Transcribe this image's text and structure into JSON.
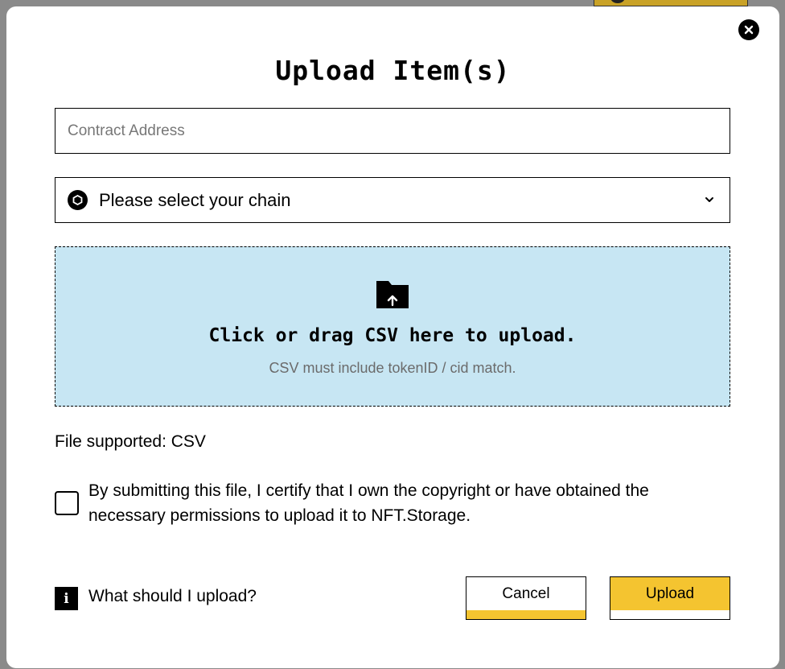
{
  "modal": {
    "title": "Upload Item(s)",
    "close_icon": "close-icon"
  },
  "form": {
    "contract_placeholder": "Contract Address",
    "contract_value": "",
    "chain_label": "Please select your chain",
    "chain_icon": "chain-icon",
    "chevron_icon": "chevron-down-icon"
  },
  "dropzone": {
    "icon": "folder-upload-icon",
    "title": "Click or drag CSV here to upload.",
    "subtitle": "CSV must include tokenID / cid match.",
    "background": "#c7e6f3"
  },
  "supported": "File supported: CSV",
  "certify": {
    "checked": false,
    "text": "By submitting this file, I certify that I own the copyright or have obtained the necessary permissions to upload it to NFT.Storage."
  },
  "help": {
    "icon": "info-icon",
    "label": "What should I upload?"
  },
  "buttons": {
    "cancel": "Cancel",
    "upload": "Upload",
    "accent": "#f4c430"
  }
}
